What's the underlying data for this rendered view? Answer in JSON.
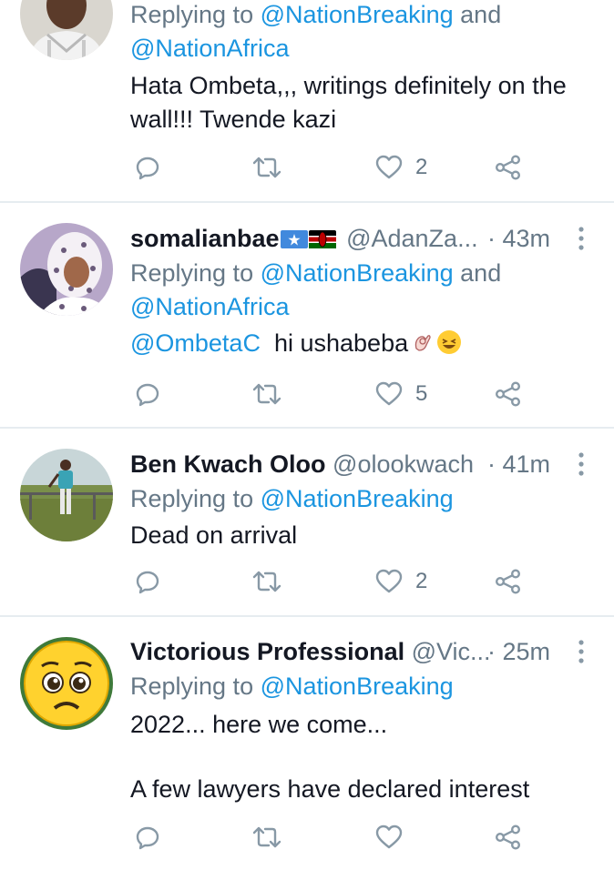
{
  "tweets": [
    {
      "reply_prefix": "Replying to",
      "mentions": [
        "@NationBreaking",
        "@NationAfrica"
      ],
      "and": "and",
      "text_lines": [
        "Hata Ombeta,,, writings definitely on the",
        "wall!!! Twende kazi"
      ],
      "likes": "2"
    },
    {
      "name": "somalianbae",
      "handle": "@AdanZa...",
      "time": "· 43m",
      "reply_prefix": "Replying to",
      "mentions": [
        "@NationBreaking",
        "@NationAfrica"
      ],
      "and": "and",
      "body_mention": "@OmbetaC",
      "text": "hi ushabeba",
      "likes": "5"
    },
    {
      "name": "Ben Kwach Oloo",
      "handle": "@olookwach",
      "time": "· 41m",
      "reply_prefix": "Replying to",
      "mentions": [
        "@NationBreaking"
      ],
      "text_lines": [
        "Dead on arrival"
      ],
      "likes": "2"
    },
    {
      "name": "Victorious Professional",
      "handle": "@Vic...",
      "time": "· 25m",
      "reply_prefix": "Replying to",
      "mentions": [
        "@NationBreaking"
      ],
      "text_lines": [
        "2022... here we come...",
        "",
        "A few lawyers have declared interest"
      ],
      "likes": ""
    }
  ],
  "icons": [
    "reply-icon",
    "retweet-icon",
    "like-icon",
    "share-icon",
    "more-icon"
  ],
  "colors": {
    "mention": "#1b95e0",
    "secondary": "#657786",
    "icon": "#8899a6",
    "divider": "#e6ecf0"
  }
}
